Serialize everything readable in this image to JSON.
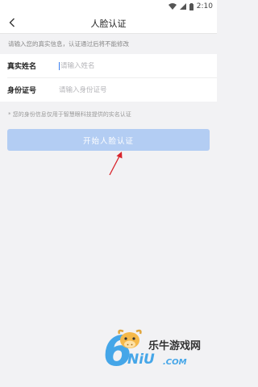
{
  "status_bar": {
    "time": "2:10",
    "icons": [
      "wifi-icon",
      "signal-icon",
      "battery-icon"
    ]
  },
  "nav": {
    "title": "人脸认证",
    "back_icon": "chevron-left-icon"
  },
  "notice": "请输入您的真实信息，认证通过后将不能修改",
  "form": {
    "name": {
      "label": "真实姓名",
      "value": "",
      "placeholder": "请输入姓名"
    },
    "id": {
      "label": "身份证号",
      "value": "",
      "placeholder": "请输入身份证号"
    }
  },
  "footnote": "* 您的身份信息仅用于智慧眼科技提供的实名认证",
  "start_button": {
    "label": "开始人脸认证",
    "enabled": false,
    "color": "#b3cdf3"
  },
  "watermark": {
    "brand_cn": "乐牛游戏网",
    "logo_digit": "6",
    "logo_text": "NiU",
    "logo_domain": ".COM"
  },
  "colors": {
    "accent": "#b3cdf3",
    "annotation_arrow": "#d8232a",
    "watermark": "#45a6e8"
  }
}
